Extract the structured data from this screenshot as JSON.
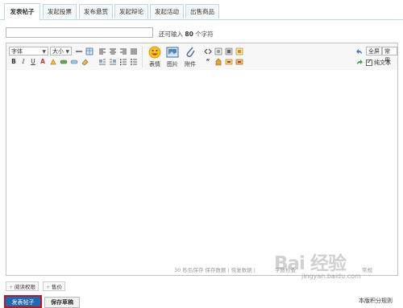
{
  "tabs": [
    {
      "label": "发表帖子",
      "active": true
    },
    {
      "label": "发起投票",
      "active": false
    },
    {
      "label": "发布悬赏",
      "active": false
    },
    {
      "label": "发起辩论",
      "active": false
    },
    {
      "label": "发起活动",
      "active": false
    },
    {
      "label": "出售商品",
      "active": false
    }
  ],
  "title_field": {
    "value": "",
    "placeholder": ""
  },
  "char_count": {
    "prefix": "还可输入",
    "number": "80",
    "suffix": "个字符"
  },
  "toolbar": {
    "font_select": "字体",
    "size_select": "大小",
    "bold": "B",
    "italic": "I",
    "underline": "U",
    "font_color": "A",
    "emoticon_label": "表情",
    "image_label": "图片",
    "attachment_label": "附件",
    "fullscreen": "全屏",
    "common": "常用",
    "plain_text": "纯文本"
  },
  "status_bar": {
    "autosave": "30 秒后保存 保存数据 | 恢复数据 |",
    "word_check": "字数检查",
    "common_settings": "常规"
  },
  "options": {
    "read_permission": "阅读权限",
    "sell": "售价"
  },
  "actions": {
    "submit": "发表帖子",
    "save_draft": "保存草稿",
    "rules": "本版积分规则"
  },
  "watermark": {
    "brand": "Bai  经验",
    "url": "jingyan.baidu.com"
  },
  "colors": {
    "tab_border": "#c2d5e3",
    "submit_bg": "#1d6bb5",
    "submit_highlight": "#c80f1e"
  },
  "icons": [
    "emoticon-icon",
    "image-icon",
    "attachment-icon",
    "undo-icon",
    "redo-icon",
    "checkbox-icon"
  ]
}
